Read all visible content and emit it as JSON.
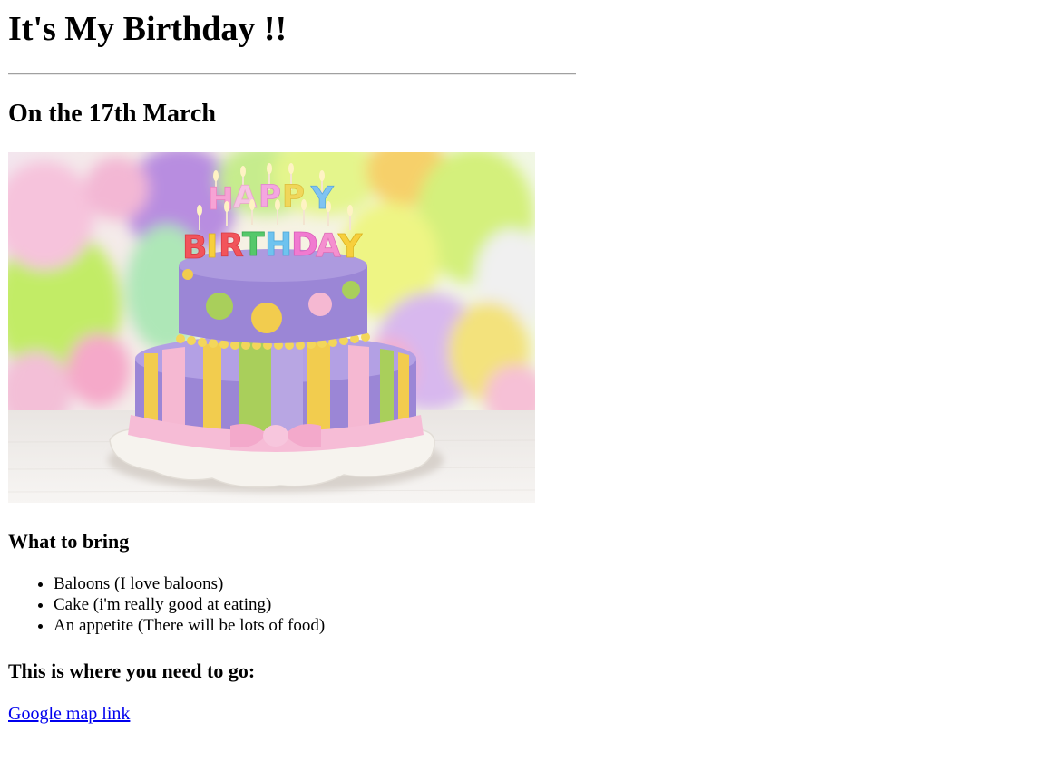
{
  "page": {
    "title": "It's My Birthday !!",
    "date_heading": "On the 17th March"
  },
  "image": {
    "subject": "Two-tier birthday cake with HAPPY BIRTHDAY candles and colorful balloons in background",
    "candle_letters_top": "HAPPY",
    "candle_letters_bottom": "BIRTHDAY",
    "colors": {
      "cake_purple": "#9b86d6",
      "cake_pink": "#f5b8d2",
      "cake_yellow": "#f2cc4e",
      "cake_green": "#a9cf5b",
      "board_white": "#f4f1ec"
    }
  },
  "bring": {
    "heading": "What to bring",
    "items": [
      "Baloons (I love baloons)",
      "Cake (i'm really good at eating)",
      "An appetite (There will be lots of food)"
    ]
  },
  "location": {
    "heading": "This is where you need to go:",
    "link_label": "Google map link"
  },
  "colors": {
    "link": "#0000ee",
    "text": "#000000",
    "background": "#ffffff"
  }
}
